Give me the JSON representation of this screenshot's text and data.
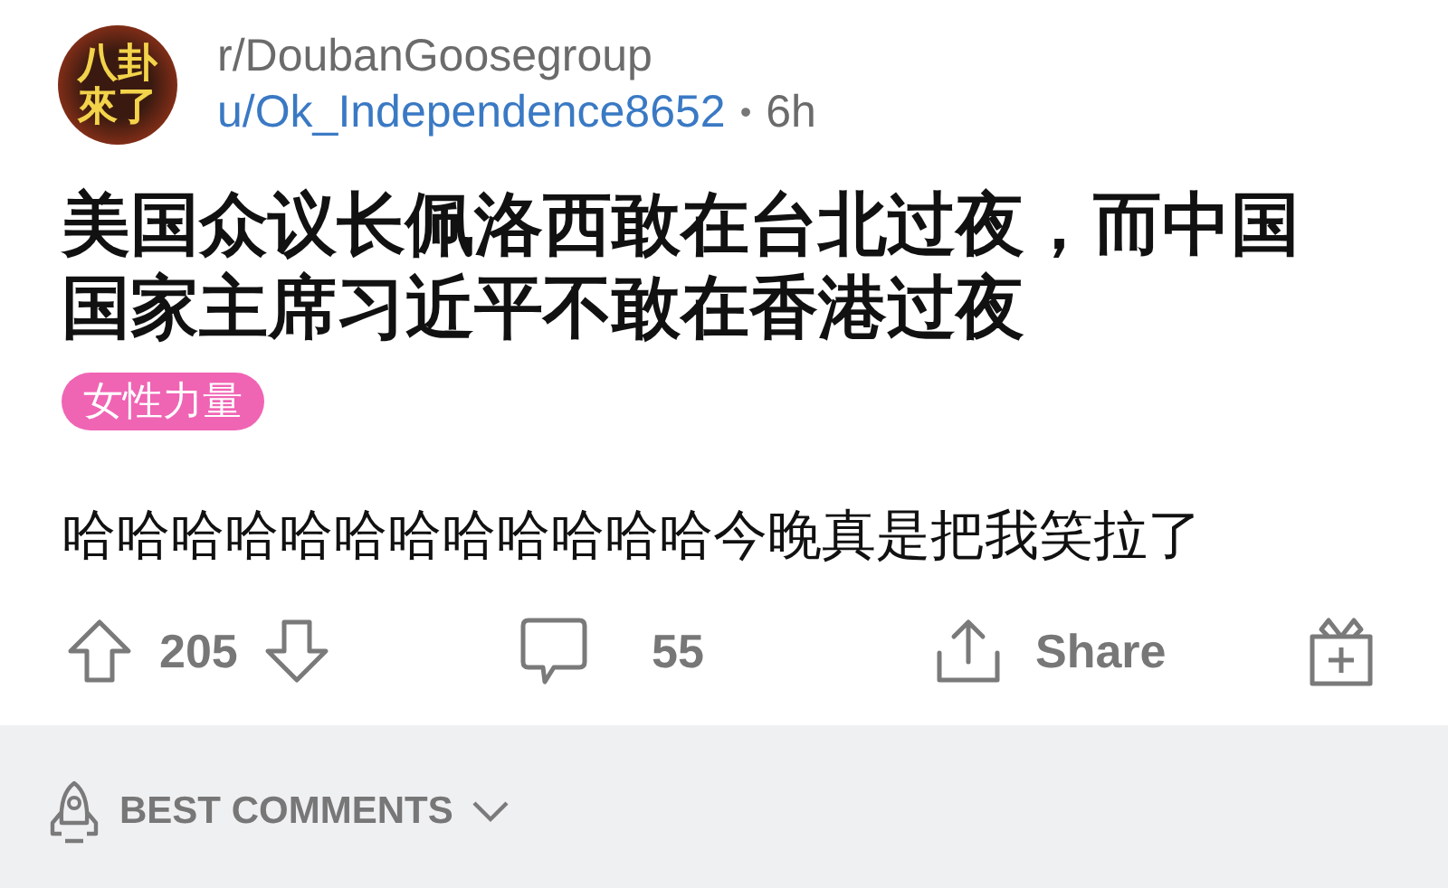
{
  "post": {
    "community": "r/DoubanGoosegroup",
    "avatar_lines": [
      "八卦",
      "來了"
    ],
    "author": "u/Ok_Independence8652",
    "separator": "•",
    "age": "6h",
    "title": "美国众议长佩洛西敢在台北过夜，而中国国家主席习近平不敢在香港过夜",
    "flair": "女性力量",
    "body": "哈哈哈哈哈哈哈哈哈哈哈哈今晚真是把我笑拉了"
  },
  "actions": {
    "upvotes": "205",
    "comments": "55",
    "share": "Share"
  },
  "comments_sort": {
    "label": "BEST COMMENTS"
  }
}
